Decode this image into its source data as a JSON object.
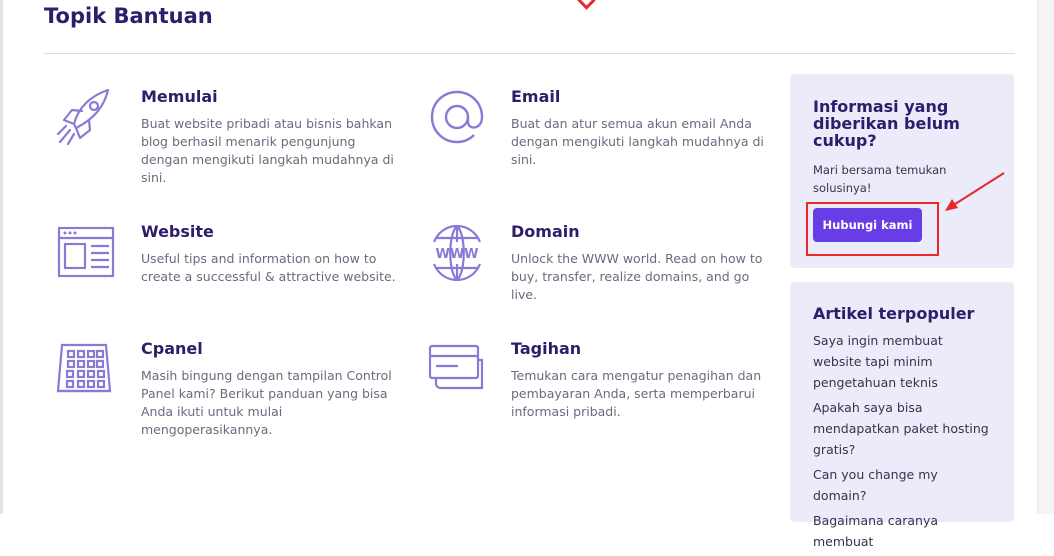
{
  "page": {
    "title": "Topik Bantuan"
  },
  "topics": [
    {
      "icon": "rocket-icon",
      "title": "Memulai",
      "description": "Buat website pribadi atau bisnis bahkan blog berhasil menarik pengunjung dengan mengikuti langkah mudahnya di sini."
    },
    {
      "icon": "at-sign-icon",
      "title": "Email",
      "description": "Buat dan atur semua akun email Anda dengan mengikuti langkah mudahnya di sini."
    },
    {
      "icon": "webpage-icon",
      "title": "Website",
      "description": "Useful tips and information on how to create a successful & attractive website."
    },
    {
      "icon": "globe-www-icon",
      "title": "Domain",
      "description": "Unlock the WWW world. Read on how to buy, transfer, realize domains, and go live."
    },
    {
      "icon": "control-panel-icon",
      "title": "Cpanel",
      "description": "Masih bingung dengan tampilan Control Panel kami? Berikut panduan yang bisa Anda ikuti untuk mulai mengoperasikannya."
    },
    {
      "icon": "credit-card-icon",
      "title": "Tagihan",
      "description": "Temukan cara mengatur penagihan dan pembayaran Anda, serta memperbarui informasi pribadi."
    }
  ],
  "sidebar": {
    "help": {
      "heading": "Informasi yang diberikan belum cukup?",
      "text": "Mari bersama temukan solusinya!",
      "button_label": "Hubungi kami"
    },
    "popular": {
      "heading": "Artikel terpopuler",
      "articles": [
        "Saya ingin membuat website tapi minim pengetahuan teknis",
        "Apakah saya bisa mendapatkan paket hosting gratis?",
        "Can you change my domain?",
        "Bagaimana caranya membuat"
      ]
    }
  },
  "colors": {
    "accent": "#673de6",
    "heading": "#2f1c6a",
    "icon": "#8c79d6",
    "card_background": "#ecebfa",
    "annotation": "#e8282b"
  }
}
